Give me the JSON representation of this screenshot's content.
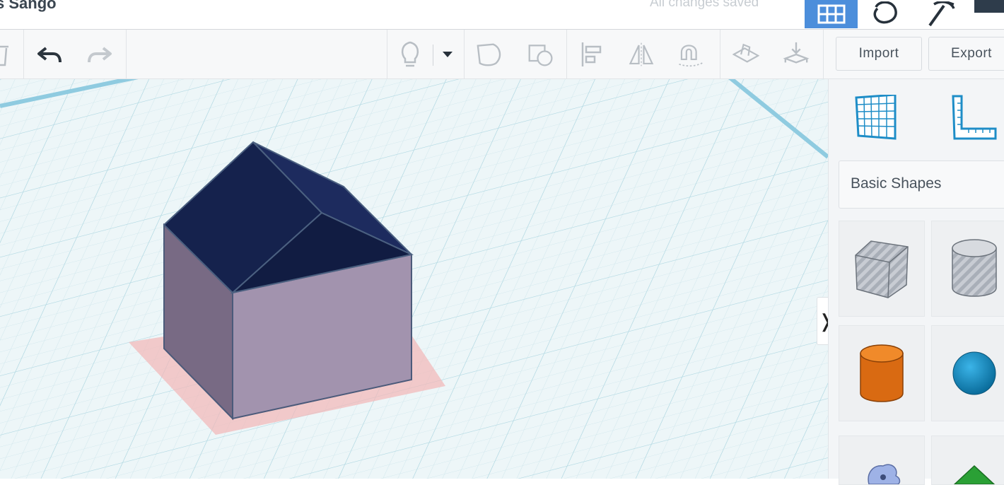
{
  "header": {
    "title": "s Sango",
    "save_status": "All changes saved"
  },
  "toolbar": {
    "import_label": "Import",
    "export_label": "Export"
  },
  "panel": {
    "category_label": "Basic Shapes",
    "collapse_glyph": "❭",
    "shapes": [
      {
        "name": "Box",
        "icon": "striped-box-icon"
      },
      {
        "name": "Cylinder",
        "icon": "striped-cylinder-icon"
      },
      {
        "name": "Cylinder",
        "icon": "orange-cylinder-icon"
      },
      {
        "name": "Sphere",
        "icon": "blue-sphere-icon"
      },
      {
        "name": "Scribble",
        "icon": "scribble-icon"
      },
      {
        "name": "Roof",
        "icon": "green-roof-icon"
      }
    ]
  },
  "colors": {
    "accent": "#4c8edb",
    "roof": "#1b2755",
    "walls": "#a293ae",
    "wall_shadow": "#786a84",
    "grid": "#b9dde7",
    "shadow": "#f2b6b6"
  }
}
